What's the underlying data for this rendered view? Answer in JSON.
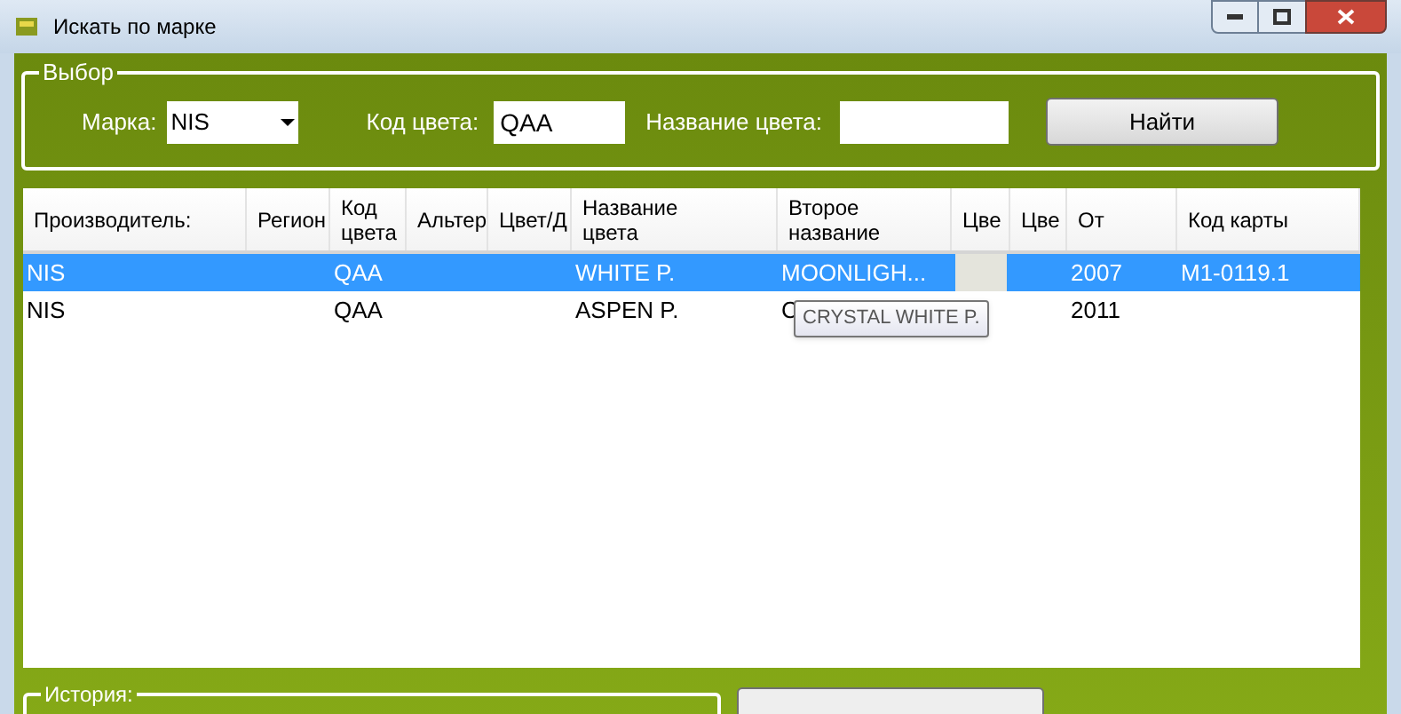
{
  "window": {
    "title": "Искать по марке"
  },
  "selection_group": {
    "title": "Выбор",
    "brand_label": "Марка:",
    "brand_value": "NIS",
    "color_code_label": "Код цвета:",
    "color_code_value": "QAA",
    "color_name_label": "Название цвета:",
    "find_button": "Найти"
  },
  "table": {
    "columns": [
      "Производитель:",
      "Регион",
      "Код цвета",
      "Альтер",
      "Цвет/Д",
      "Название цвета",
      "Второе название",
      "Цве",
      "Цве",
      "От",
      "Код карты"
    ],
    "rows": [
      {
        "selected": true,
        "cells": [
          "NIS",
          "",
          "QAA",
          "",
          "",
          "WHITE P.",
          "MOONLIGH...",
          "",
          "",
          "2007",
          "M1-0119.1"
        ],
        "color": "#e4e4dc"
      },
      {
        "selected": false,
        "cells": [
          "NIS",
          "",
          "QAA",
          "",
          "",
          "ASPEN P.",
          "C",
          "",
          "",
          "2011",
          ""
        ]
      }
    ]
  },
  "tooltip": "CRYSTAL WHITE P.",
  "history_group": {
    "title": "История:"
  }
}
